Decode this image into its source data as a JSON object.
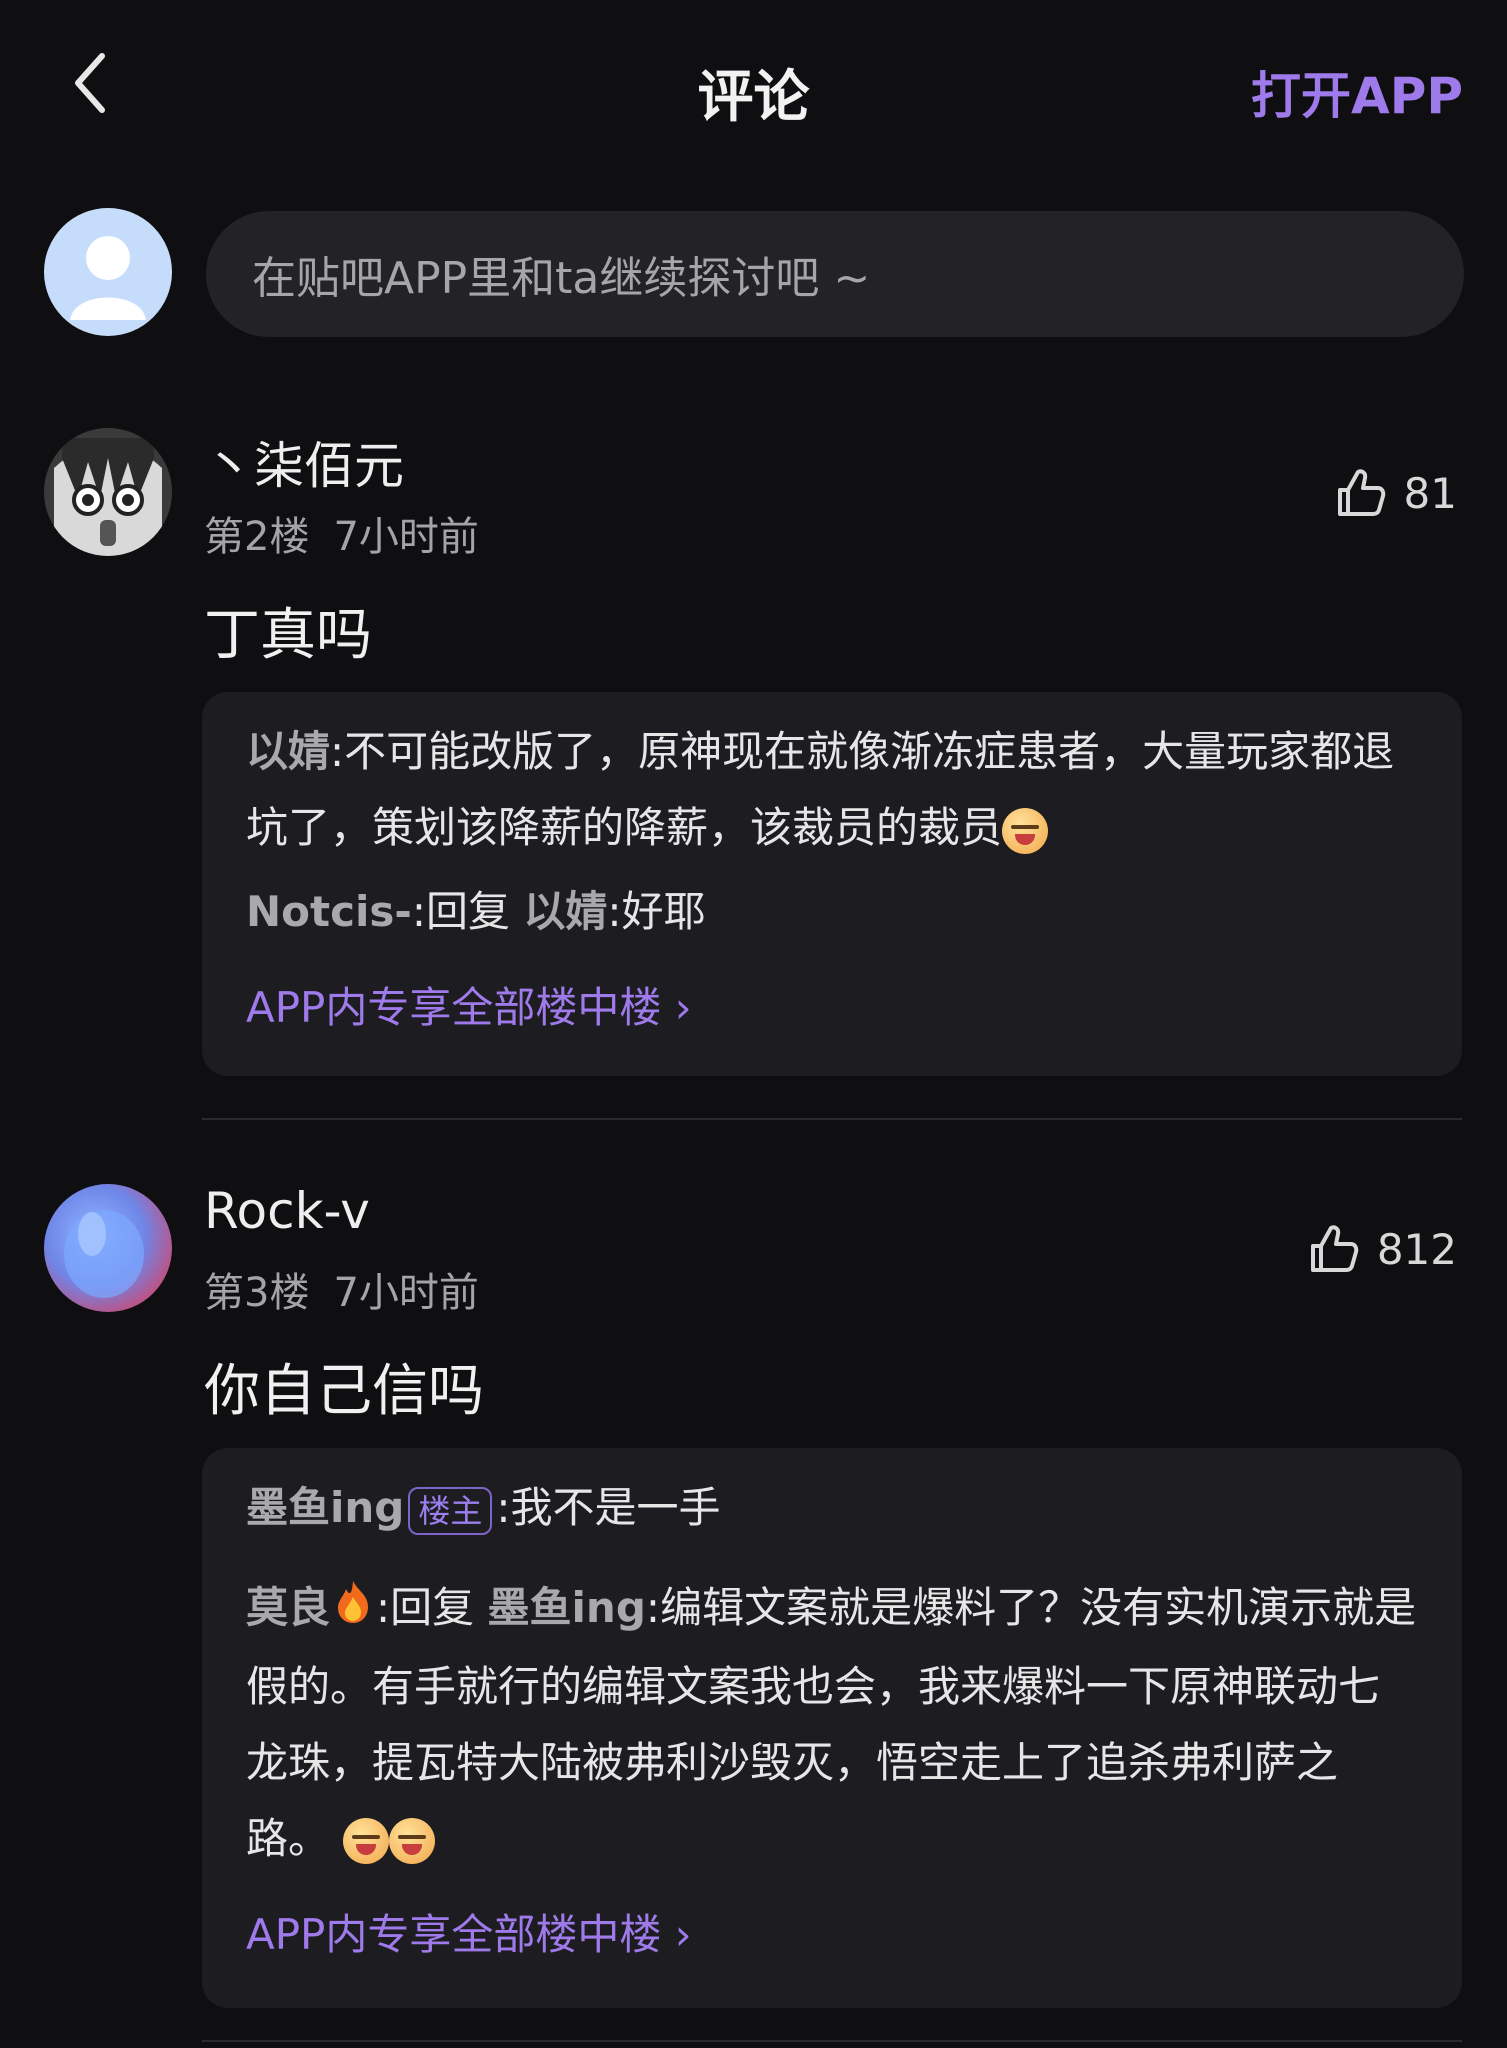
{
  "header": {
    "title": "评论",
    "open_app": "打开APP"
  },
  "composer": {
    "placeholder": "在贴吧APP里和ta继续探讨吧 ~"
  },
  "comments": [
    {
      "username": "丶柒佰元",
      "floor": "第2楼",
      "time": "7小时前",
      "likes": "81",
      "text": "丁真吗",
      "replies": [
        {
          "name": "以婧",
          "sep": ":",
          "text": "不可能改版了，原神现在就像渐冻症患者，大量玩家都退坑了，策划该降薪的降薪，该裁员的裁员"
        },
        {
          "name": "Notcis-",
          "sep": ":回复 ",
          "target": "以婧",
          "sep2": ":",
          "text": "好耶"
        }
      ],
      "more": "APP内专享全部楼中楼 ›"
    },
    {
      "username": "Rock-v",
      "floor": "第3楼",
      "time": "7小时前",
      "likes": "812",
      "text": "你自己信吗",
      "replies": [
        {
          "name": "墨鱼ing",
          "badge": "楼主",
          "sep": ":",
          "text": "我不是一手"
        },
        {
          "name": "莫良",
          "sep": ":回复 ",
          "target": "墨鱼ing",
          "sep2": ":",
          "text": "编辑文案就是爆料了？没有实机演示就是假的。有手就行的编辑文案我也会，我来爆料一下原神联动七龙珠，提瓦特大陆被弗利沙毁灭，悟空走上了追杀弗利萨之路。"
        }
      ],
      "more": "APP内专享全部楼中楼 ›"
    }
  ]
}
